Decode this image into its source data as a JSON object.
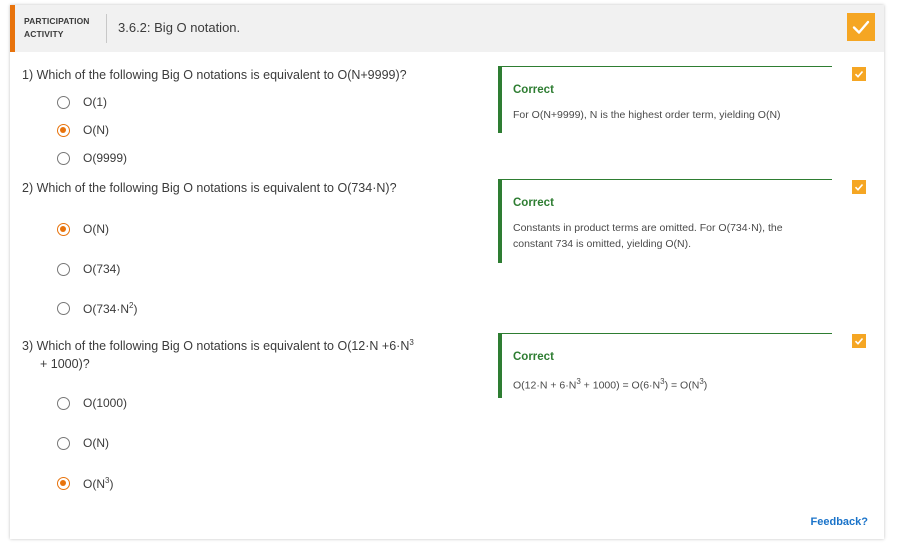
{
  "header": {
    "kind_line1": "PARTICIPATION",
    "kind_line2": "ACTIVITY",
    "title": "3.6.2: Big O notation.",
    "complete_icon": "check-icon",
    "accent_color": "#e8730c",
    "complete_color": "#f5a623"
  },
  "questions": [
    {
      "number": "1)",
      "text": "Which of the following Big O notations is equivalent to O(N+9999)?",
      "options": [
        "O(1)",
        "O(N)",
        "O(9999)"
      ],
      "selected": "O(N)",
      "feedback_status": "Correct",
      "feedback_text": "For O(N+9999), N is the highest order term, yielding O(N)"
    },
    {
      "number": "2)",
      "text": "Which of the following Big O notations is equivalent to O(734·N)?",
      "options": [
        "O(N)",
        "O(734)",
        "O(734·N",
        "2",
        ")"
      ],
      "selected": "O(N)",
      "feedback_status": "Correct",
      "feedback_text": "Constants in product terms are omitted. For O(734·N), the constant 734 is omitted, yielding O(N)."
    },
    {
      "number": "3)",
      "text_a": "Which of the following Big O notations is equivalent to O(12·N +6·N",
      "text_sup": "3",
      "text_b": "+ 1000)?",
      "options": [
        "O(1000)",
        "O(N)",
        "O(N",
        "3",
        ")"
      ],
      "selected": "O(N3)",
      "feedback_status": "Correct",
      "feedback_a": "O(12·N + 6·N",
      "feedback_sup1": "3",
      "feedback_b": " + 1000) = O(6·N",
      "feedback_sup2": "3",
      "feedback_c": ") = O(N",
      "feedback_sup3": "3",
      "feedback_d": ")"
    }
  ],
  "feedback_link": "Feedback?",
  "link_color": "#1a73c9",
  "correct_color": "#2e7d32"
}
